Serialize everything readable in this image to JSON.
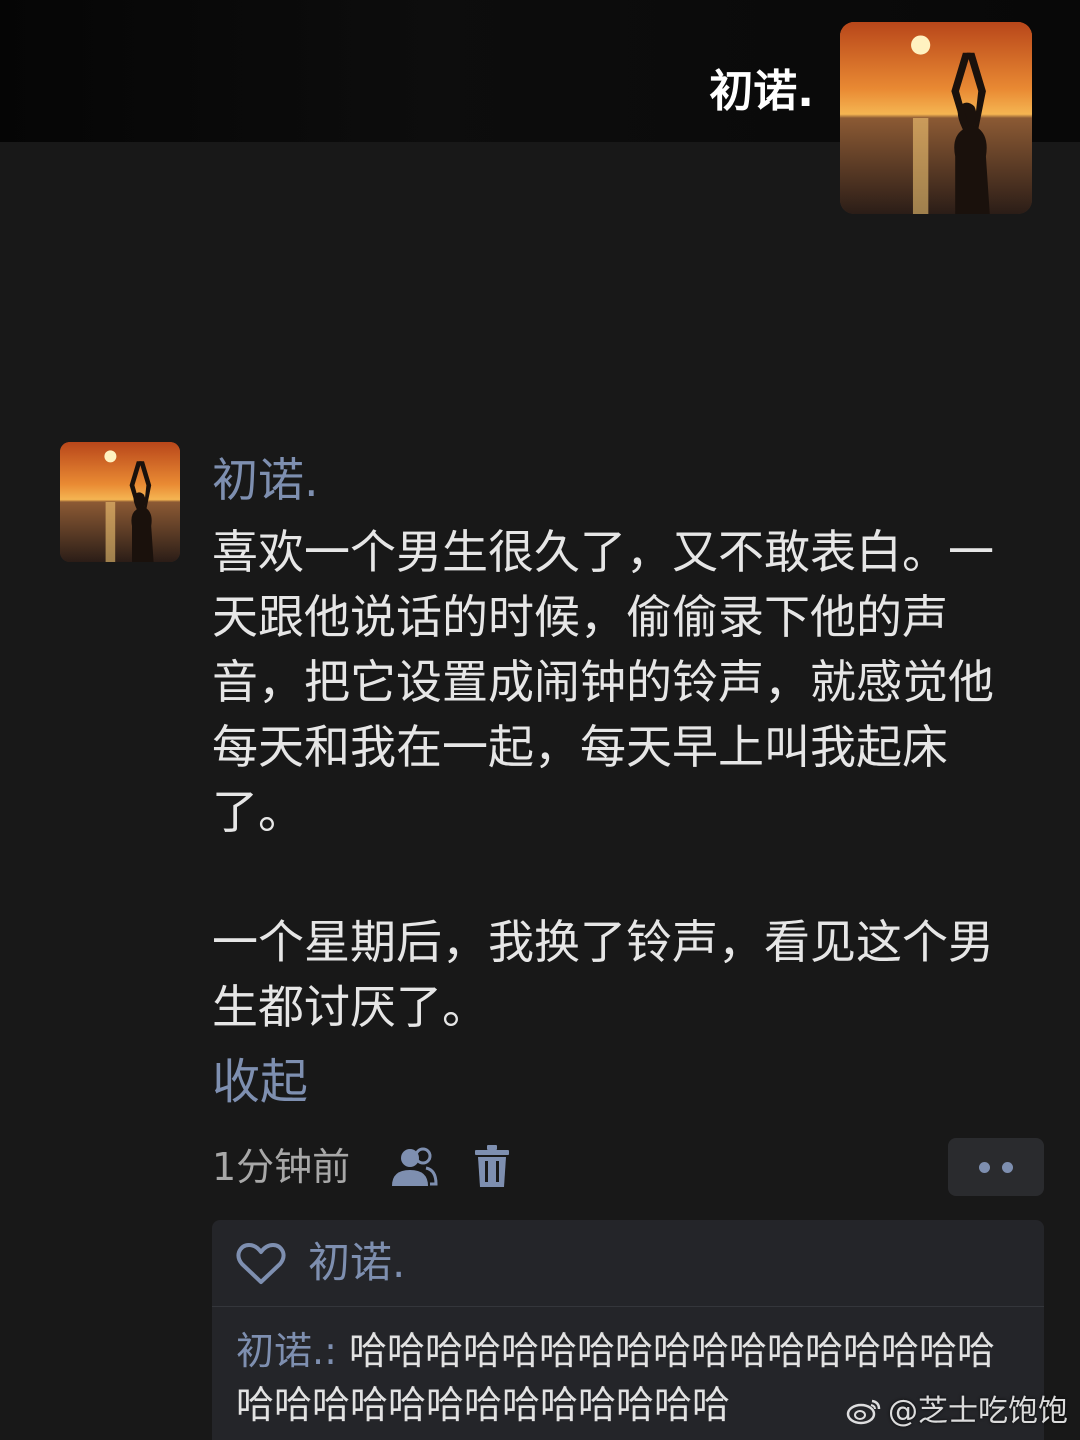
{
  "header": {
    "name": "初诺."
  },
  "comment": {
    "author": "初诺.",
    "paragraphs": [
      "喜欢一个男生很久了，又不敢表白。一天跟他说话的时候，偷偷录下他的声音，把它设置成闹钟的铃声，就感觉他每天和我在一起，每天早上叫我起床了。",
      "一个星期后，我换了铃声，看见这个男生都讨厌了。"
    ],
    "collapse_label": "收起",
    "timestamp": "1分钟前"
  },
  "reply_panel": {
    "liked_by": "初诺.",
    "reply_author": "初诺.:",
    "reply_content": " 哈哈哈哈哈哈哈哈哈哈哈哈哈哈哈哈哈哈哈哈哈哈哈哈哈哈哈哈哈哈"
  },
  "watermark": {
    "text": "@芝士吃饱饱"
  },
  "icons": [
    "friends-icon",
    "trash-icon",
    "more-icon",
    "heart-icon",
    "weibo-logo"
  ],
  "colors": {
    "background": "#181818",
    "link_blue": "#7e8fb0",
    "text": "#e6e6e6",
    "meta_gray": "#a8a8a8",
    "panel": "#242529"
  }
}
